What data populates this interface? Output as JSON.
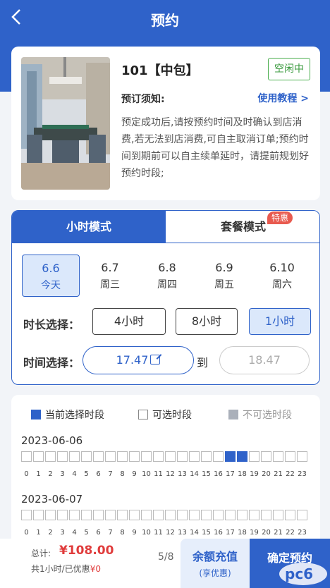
{
  "header": {
    "title": "预约",
    "back_icon": "chevron-left-icon"
  },
  "room": {
    "name": "101【中包】",
    "status": "空闲中",
    "notice_label": "预订须知:",
    "tutorial_link": "使用教程 >",
    "notice_text": "预定成功后,请按预约时间及时确认到店消费,若无法到店消费,可自主取消订单;预约时间到期前可以自主续单延时，请提前规划好预约时段;"
  },
  "booking": {
    "tabs": [
      {
        "label": "小时模式",
        "active": true
      },
      {
        "label": "套餐模式",
        "active": false
      }
    ],
    "promo_badge": "特惠",
    "dates": [
      {
        "date": "6.6",
        "day": "今天",
        "selected": true
      },
      {
        "date": "6.7",
        "day": "周三",
        "selected": false
      },
      {
        "date": "6.8",
        "day": "周四",
        "selected": false
      },
      {
        "date": "6.9",
        "day": "周五",
        "selected": false
      },
      {
        "date": "6.10",
        "day": "周六",
        "selected": false
      }
    ],
    "duration_label": "时长选择：",
    "durations": [
      {
        "label": "4小时",
        "selected": false
      },
      {
        "label": "8小时",
        "selected": false
      },
      {
        "label": "1小时",
        "selected": true
      }
    ],
    "time_label": "时间选择：",
    "start_time": "17.47",
    "to_label": "到",
    "end_time": "18.47"
  },
  "slots": {
    "legend": {
      "current": "当前选择时段",
      "available": "可选时段",
      "unavailable": "不可选时段"
    },
    "colors": {
      "selected": "#2f62c9",
      "available": "#ffffff",
      "unavailable": "#aab0ba"
    },
    "days": [
      {
        "date": "2023-06-06",
        "selected_hours": [
          17,
          18
        ]
      },
      {
        "date": "2023-06-07",
        "selected_hours": []
      }
    ],
    "hours": [
      "0",
      "1",
      "2",
      "3",
      "4",
      "5",
      "6",
      "7",
      "8",
      "9",
      "10",
      "11",
      "12",
      "13",
      "14",
      "15",
      "16",
      "17",
      "18",
      "19",
      "20",
      "21",
      "22",
      "23"
    ]
  },
  "footer": {
    "total_label": "总计:",
    "total_price": "¥108.00",
    "total_sub": "共1小时/已优惠",
    "discount": "¥0",
    "page_indicator": "5/8",
    "recharge_main": "余额充值",
    "recharge_sub": "(享优惠)",
    "confirm": "确定预约"
  },
  "brand": {
    "accent": "#2f62c9",
    "status_green": "#3a9a3e",
    "price_red": "#e03c3c"
  }
}
